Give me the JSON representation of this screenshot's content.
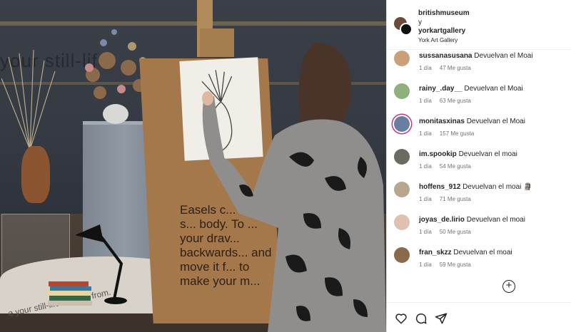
{
  "post": {
    "photo_wall_text": "your still-life",
    "board_text": "Easels c... larger s... body. To ... your drav... backwards... and move it f... to make your m...",
    "platform_text": "e your still-life to draw from."
  },
  "header": {
    "user1": "britishmuseum",
    "conjunction": "y",
    "user2": "yorkartgallery",
    "location": "York Art Gallery"
  },
  "comments": [
    {
      "user": "sussanasusana",
      "text": "Devuelvan el Moai",
      "time": "1 día",
      "likes": "47 Me gusta",
      "avatar_color": "#c9a07a",
      "ring": false
    },
    {
      "user": "rainy_.day__",
      "text": "Devuelvan el Moai",
      "time": "1 día",
      "likes": "63 Me gusta",
      "avatar_color": "#8fb07a",
      "ring": false
    },
    {
      "user": "monitasxinas",
      "text": "Devuelvan el Moai",
      "time": "1 día",
      "likes": "157 Me gusta",
      "avatar_color": "#6a7fa0",
      "ring": true
    },
    {
      "user": "im.spookip",
      "text": "Devuelvan el moai",
      "time": "1 día",
      "likes": "54 Me gusta",
      "avatar_color": "#6d6a60",
      "ring": false
    },
    {
      "user": "hoffens_912",
      "text": "Devuelvan el moai 🗿",
      "time": "1 día",
      "likes": "71 Me gusta",
      "avatar_color": "#b8a68e",
      "ring": false
    },
    {
      "user": "joyas_de.lirio",
      "text": "Devuelvan el moai",
      "time": "1 día",
      "likes": "50 Me gusta",
      "avatar_color": "#e0c0b0",
      "ring": false
    },
    {
      "user": "fran_skzz",
      "text": "Devuelvan el moai",
      "time": "1 día",
      "likes": "59 Me gusta",
      "avatar_color": "#8a6a4a",
      "ring": false
    }
  ],
  "add_comment_label": "+",
  "icons": {
    "like": "heart-icon",
    "comment": "comment-icon",
    "share": "share-icon",
    "add": "add-circle-icon"
  }
}
